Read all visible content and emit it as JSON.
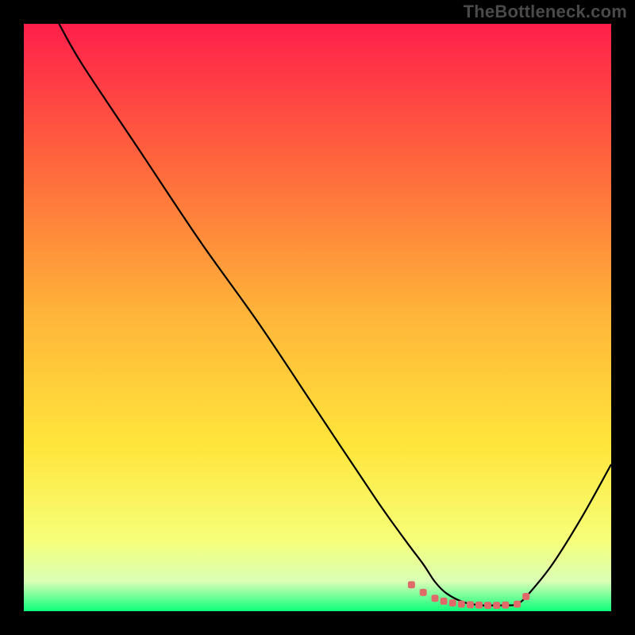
{
  "watermark": {
    "text": "TheBottleneck.com"
  },
  "chart_data": {
    "type": "line",
    "title": "",
    "xlabel": "",
    "ylabel": "",
    "xlim": [
      0,
      100
    ],
    "ylim": [
      0,
      100
    ],
    "grid": false,
    "legend": false,
    "gradient_stops": [
      {
        "offset": 0.0,
        "color": "#ff1f4b"
      },
      {
        "offset": 0.25,
        "color": "#ff6a3c"
      },
      {
        "offset": 0.5,
        "color": "#ffb63a"
      },
      {
        "offset": 0.72,
        "color": "#ffe63b"
      },
      {
        "offset": 0.88,
        "color": "#f6ff7a"
      },
      {
        "offset": 0.95,
        "color": "#d9ffb6"
      },
      {
        "offset": 1.0,
        "color": "#0cff7a"
      }
    ],
    "series": [
      {
        "name": "curve",
        "color": "#000000",
        "x": [
          6,
          10,
          20,
          30,
          40,
          50,
          60,
          65,
          68,
          70,
          72,
          75,
          78,
          80,
          82,
          84,
          86,
          90,
          95,
          100
        ],
        "y": [
          100,
          93,
          78,
          63,
          49,
          34,
          19,
          12,
          8,
          5,
          3,
          1.5,
          1,
          1,
          1,
          1.2,
          3,
          8,
          16,
          25
        ]
      },
      {
        "name": "flat-region-markers",
        "color": "#e06a6a",
        "type": "scatter",
        "x": [
          66,
          68,
          70,
          71.5,
          73,
          74.5,
          76,
          77.5,
          79,
          80.5,
          82,
          84,
          85.5
        ],
        "y": [
          4.5,
          3.2,
          2.2,
          1.7,
          1.4,
          1.2,
          1.1,
          1.05,
          1.0,
          1.0,
          1.05,
          1.2,
          2.5
        ]
      }
    ]
  }
}
